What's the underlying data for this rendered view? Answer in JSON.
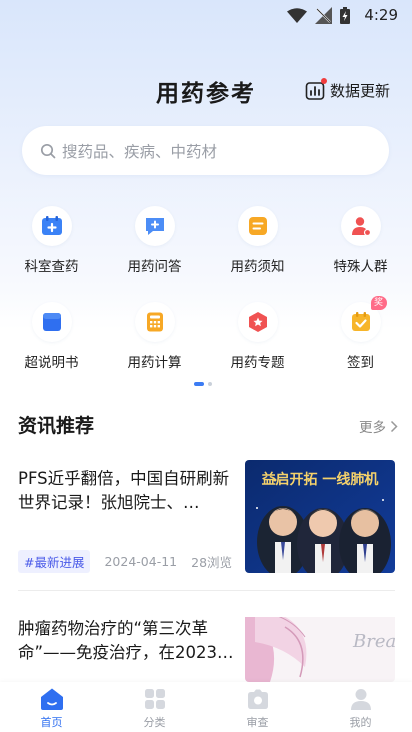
{
  "status": {
    "time": "4:29"
  },
  "header": {
    "title": "用药参考",
    "update_label": "数据更新"
  },
  "search": {
    "placeholder": "搜药品、疾病、中药材"
  },
  "features": {
    "row1": [
      {
        "label": "科室查药",
        "icon": "department-medicine-icon"
      },
      {
        "label": "用药问答",
        "icon": "qa-chat-icon"
      },
      {
        "label": "用药须知",
        "icon": "notice-icon"
      },
      {
        "label": "特殊人群",
        "icon": "special-people-icon"
      }
    ],
    "row2": [
      {
        "label": "超说明书",
        "icon": "off-label-icon"
      },
      {
        "label": "用药计算",
        "icon": "calculator-icon"
      },
      {
        "label": "用药专题",
        "icon": "topic-badge-icon"
      },
      {
        "label": "签到",
        "icon": "checkin-icon",
        "badge": "奖"
      }
    ]
  },
  "news": {
    "title": "资讯推荐",
    "more_label": "更多",
    "articles": [
      {
        "title": "PFS近乎翻倍，中国自研刷新世界记录！张旭院士、…",
        "tag": "#最新进展",
        "date": "2024-04-11",
        "views": "28浏览",
        "thumb_text": "益启开拓 一线肺机"
      },
      {
        "title": "肿瘤药物治疗的“第三次革命”——免疫治疗，在2023…",
        "thumb_text": "Brea CANC"
      }
    ]
  },
  "tabs": [
    {
      "label": "首页",
      "active": true
    },
    {
      "label": "分类"
    },
    {
      "label": "审查"
    },
    {
      "label": "我的"
    }
  ],
  "colors": {
    "accent": "#2f6ff0",
    "badge": "#f03c3c"
  }
}
